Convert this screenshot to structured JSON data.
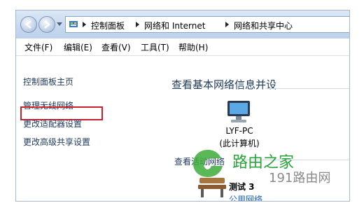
{
  "address": {
    "crumbs": [
      "控制面板",
      "网络和 Internet",
      "网络和共享中心"
    ]
  },
  "menu": [
    "文件(F)",
    "编辑(E)",
    "查看(V)",
    "工具(T)",
    "帮助(H)"
  ],
  "sidebar": {
    "items": [
      {
        "label": "控制面板主页"
      },
      {
        "label": "管理无线网络"
      },
      {
        "label": "更改适配器设置"
      },
      {
        "label": "更改高级共享设置"
      }
    ]
  },
  "main": {
    "heading": "查看基本网络信息并设",
    "computer_name": "LYF-PC",
    "computer_sub": "(此计算机)",
    "active_label": "查看活动网络",
    "network_name": "测试  3",
    "network_type": "公用网络"
  },
  "watermark": {
    "line1": "路由之家",
    "line2": "191路由网"
  },
  "icons": [
    "back-icon",
    "forward-icon",
    "control-panel-icon",
    "computer-icon",
    "bench-icon",
    "watermark-logo"
  ]
}
